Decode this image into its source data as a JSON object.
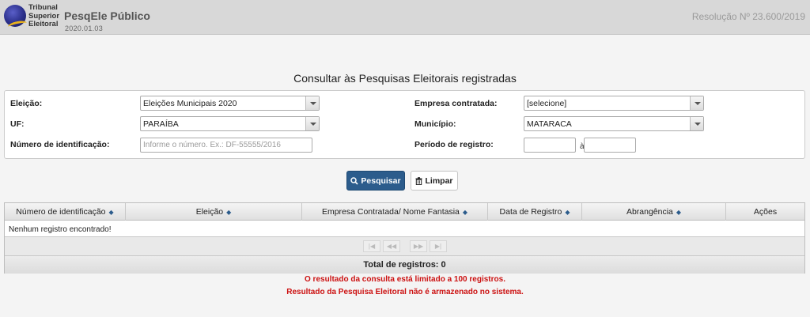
{
  "header": {
    "logo_lines": [
      "Tribunal",
      "Superior",
      "Eleitoral"
    ],
    "app_title": "PesqEle Público",
    "version": "2020.01.03",
    "resolution": "Resolução Nº 23.600/2019"
  },
  "page_title": "Consultar às Pesquisas Eleitorais registradas",
  "form": {
    "eleicao": {
      "label": "Eleição:",
      "value": "Eleições Municipais 2020"
    },
    "empresa": {
      "label": "Empresa contratada:",
      "value": "[selecione]"
    },
    "uf": {
      "label": "UF:",
      "value": "PARAÍBA"
    },
    "municipio": {
      "label": "Município:",
      "value": "MATARACA"
    },
    "numero": {
      "label": "Número de identificação:",
      "value": "",
      "placeholder": "Informe o número. Ex.: DF-55555/2016"
    },
    "periodo": {
      "label": "Período de registro:",
      "separator": "à",
      "from": "",
      "to": ""
    }
  },
  "buttons": {
    "search": "Pesquisar",
    "clear": "Limpar"
  },
  "table": {
    "columns": [
      "Número de identificação",
      "Eleição",
      "Empresa Contratada/ Nome Fantasia",
      "Data de Registro",
      "Abrangência",
      "Ações"
    ],
    "empty_message": "Nenhum registro encontrado!",
    "pager": [
      "|◀",
      "◀◀",
      "▶▶",
      "▶|"
    ],
    "total": "Total de registros: 0"
  },
  "warnings": [
    "O resultado da consulta está limitado a 100 registros.",
    "Resultado da Pesquisa Eleitoral não é armazenado no sistema."
  ],
  "colors": {
    "primary": "#2c5c8c",
    "warning": "#cc1111",
    "header_bg": "#d8d8d8"
  }
}
